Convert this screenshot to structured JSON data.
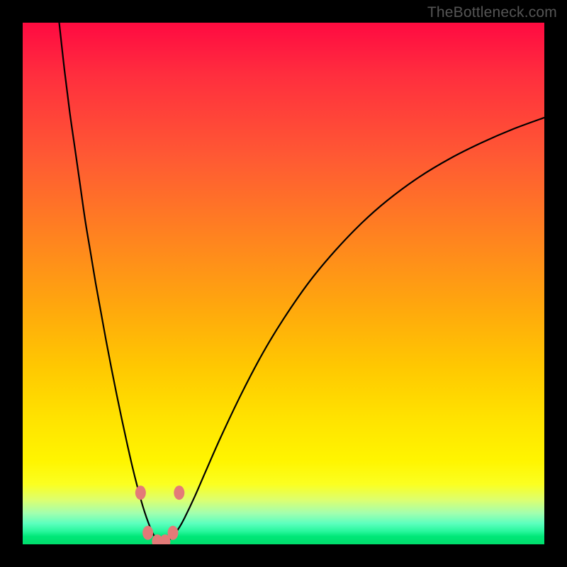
{
  "watermark": "TheBottleneck.com",
  "colors": {
    "frame": "#000000",
    "gradient_top": "#ff0b3f",
    "gradient_bottom": "#00de6c",
    "curve": "#000000",
    "marker_fill": "#e37a78",
    "marker_stroke": "#c5524f"
  },
  "chart_data": {
    "type": "line",
    "title": "",
    "xlabel": "",
    "ylabel": "",
    "xlim": [
      0,
      100
    ],
    "ylim": [
      0,
      100
    ],
    "grid": false,
    "notes": "V-shaped bottleneck curve; axes are unlabeled so values are read in percent of plot width/height. Background gradient runs red (high y) to green (low y). Minimum of curve near x≈26, y≈0.3. Six elliptical markers lie on the curve near the trough.",
    "series": [
      {
        "name": "bottleneck-curve",
        "x": [
          7,
          8,
          9,
          10,
          11,
          12,
          13,
          14,
          15,
          16,
          17,
          18,
          19,
          20,
          21,
          22,
          23,
          24,
          25,
          26,
          27,
          28,
          29,
          30,
          31,
          33,
          35,
          38,
          42,
          46,
          50,
          55,
          60,
          65,
          70,
          76,
          82,
          88,
          94,
          100
        ],
        "y": [
          100,
          91,
          83,
          76,
          69,
          62,
          56,
          50,
          44.5,
          39,
          33.8,
          28.8,
          24,
          19.4,
          15,
          11,
          7.4,
          4.4,
          2,
          0.6,
          0.4,
          0.8,
          1.8,
          3.2,
          5.0,
          9.2,
          13.8,
          20.6,
          29.0,
          36.6,
          43.2,
          50.4,
          56.4,
          61.6,
          66.0,
          70.4,
          74.0,
          77.0,
          79.6,
          81.8
        ]
      }
    ],
    "markers": [
      {
        "x": 22.6,
        "y": 9.9
      },
      {
        "x": 24.0,
        "y": 2.2
      },
      {
        "x": 25.8,
        "y": 0.55
      },
      {
        "x": 27.3,
        "y": 0.55
      },
      {
        "x": 28.8,
        "y": 2.2
      },
      {
        "x": 30.0,
        "y": 9.9
      }
    ]
  }
}
